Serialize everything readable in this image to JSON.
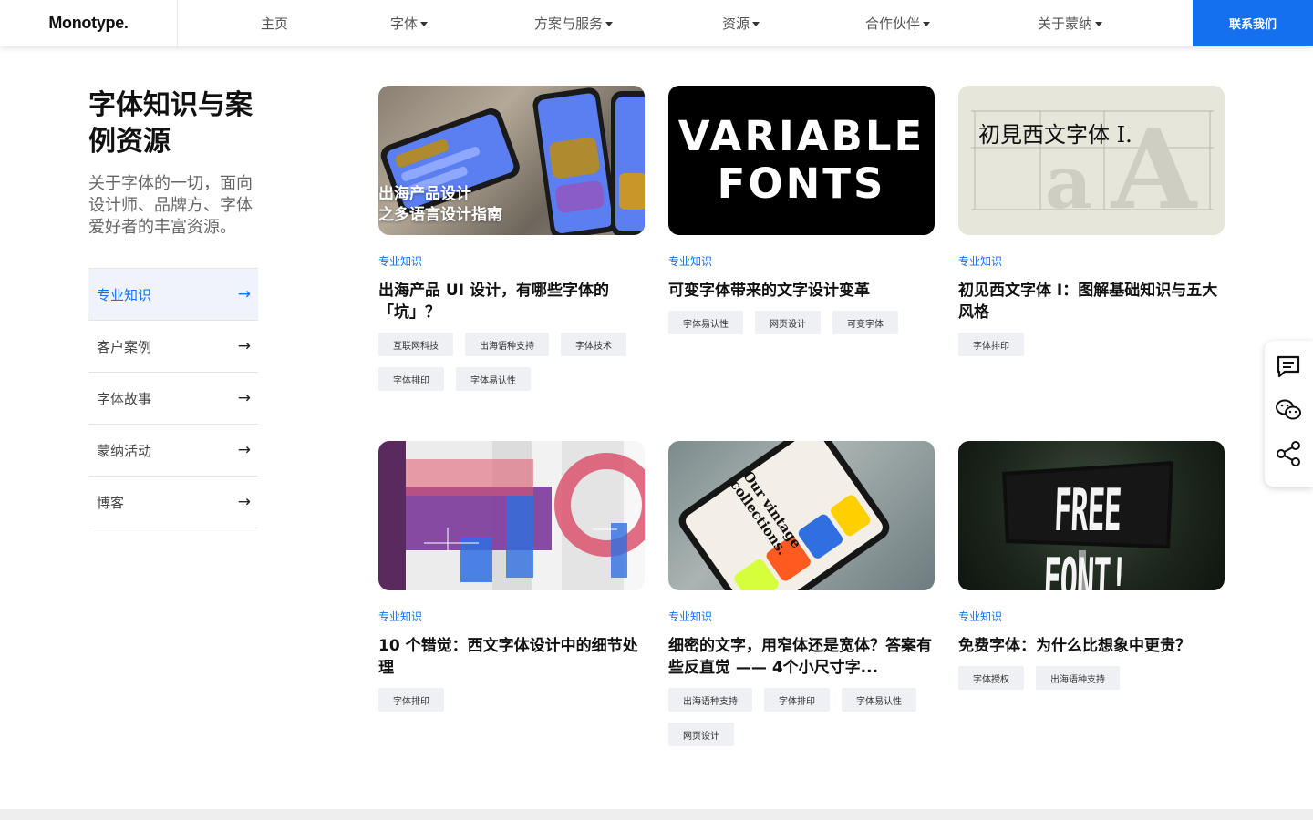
{
  "header": {
    "logo": "Monotype.",
    "nav": [
      {
        "label": "主页",
        "dropdown": false
      },
      {
        "label": "字体",
        "dropdown": true
      },
      {
        "label": "方案与服务",
        "dropdown": true
      },
      {
        "label": "资源",
        "dropdown": true
      },
      {
        "label": "合作伙伴",
        "dropdown": true
      },
      {
        "label": "关于蒙纳",
        "dropdown": true
      }
    ],
    "contact": "联系我们"
  },
  "sidebar": {
    "title": "字体知识与案例资源",
    "description": "关于字体的一切，面向设计师、品牌方、字体爱好者的丰富资源。",
    "items": [
      {
        "label": "专业知识",
        "active": true
      },
      {
        "label": "客户案例",
        "active": false
      },
      {
        "label": "字体故事",
        "active": false
      },
      {
        "label": "蒙纳活动",
        "active": false
      },
      {
        "label": "博客",
        "active": false
      }
    ],
    "arrow": "→"
  },
  "cards": [
    {
      "image_overlay": "出海产品设计\n之多语言设计指南",
      "category": "专业知识",
      "title": "出海产品 UI 设计，有哪些字体的「坑」？",
      "tags": [
        "互联网科技",
        "出海语种支持",
        "字体技术",
        "字体排印",
        "字体易认性"
      ]
    },
    {
      "image_overlay": "VARIABLE\nFONTS",
      "category": "专业知识",
      "title": "可变字体带来的文字设计变革",
      "tags": [
        "字体易认性",
        "网页设计",
        "可变字体"
      ]
    },
    {
      "image_overlay": "初見西文字体 I.",
      "category": "专业知识",
      "title": "初见西文字体 I：图解基础知识与五大风格",
      "tags": [
        "字体排印"
      ]
    },
    {
      "image_overlay": "",
      "category": "专业知识",
      "title": "10 个错觉：西文字体设计中的细节处理",
      "tags": [
        "字体排印"
      ]
    },
    {
      "image_overlay": "Our vintage collections.",
      "category": "专业知识",
      "title": "细密的文字，用窄体还是宽体？答案有些反直觉 —— 4个小尺寸字...",
      "tags": [
        "出海语种支持",
        "字体排印",
        "字体易认性",
        "网页设计"
      ]
    },
    {
      "image_overlay": "FREE FONT!",
      "category": "专业知识",
      "title": "免费字体：为什么比想象中更贵？",
      "tags": [
        "字体授权",
        "出海语种支持"
      ]
    }
  ],
  "float_icons": [
    "chat-icon",
    "wechat-icon",
    "share-icon"
  ],
  "colors": {
    "accent": "#1570ef",
    "tag_bg": "#eef0f3",
    "active_bg": "#f0f3f9"
  }
}
